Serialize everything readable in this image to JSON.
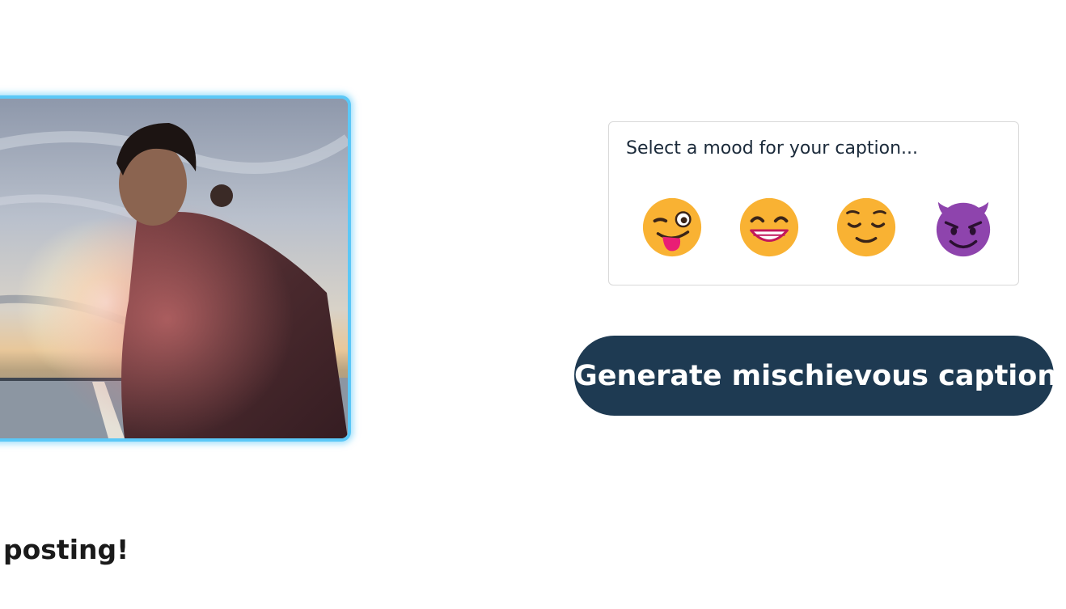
{
  "photo": {
    "alt": "uploaded photo",
    "frame_color": "#5bc8f7"
  },
  "mood_card": {
    "prompt": "Select a mood for your caption...",
    "options": [
      {
        "name": "winking-tongue",
        "emoji": "😜"
      },
      {
        "name": "grinning",
        "emoji": "😁"
      },
      {
        "name": "relieved",
        "emoji": "😌"
      },
      {
        "name": "smiling-devil",
        "emoji": "😈"
      }
    ]
  },
  "generate_button": {
    "label": "Generate mischievous caption",
    "color": "#1e3a52"
  },
  "status": {
    "text": "posting!"
  }
}
